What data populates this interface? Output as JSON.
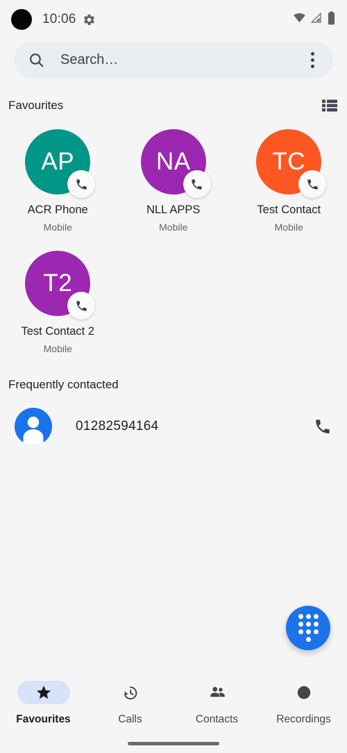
{
  "status_bar": {
    "time": "10:06",
    "gear_icon": "gear-icon",
    "wifi_icon": "wifi-icon",
    "signal_icon": "cellular-signal-icon",
    "battery_icon": "battery-full-icon"
  },
  "search": {
    "placeholder": "Search…",
    "search_icon": "search-icon",
    "overflow_icon": "overflow-menu-icon"
  },
  "favourites_section": {
    "title": "Favourites",
    "view_toggle_icon": "list-view-icon",
    "contacts": [
      {
        "initials": "AP",
        "name": "ACR Phone",
        "label": "Mobile",
        "color": "#009688",
        "badge_icon": "phone-call-icon"
      },
      {
        "initials": "NA",
        "name": "NLL APPS",
        "label": "Mobile",
        "color": "#9c27b0",
        "badge_icon": "phone-call-icon"
      },
      {
        "initials": "TC",
        "name": "Test Contact",
        "label": "Mobile",
        "color": "#ff5722",
        "badge_icon": "phone-call-icon"
      },
      {
        "initials": "T2",
        "name": "Test Contact 2",
        "label": "Mobile",
        "color": "#9c27b0",
        "badge_icon": "phone-call-icon"
      }
    ]
  },
  "frequently_contacted": {
    "title": "Frequently contacted",
    "entries": [
      {
        "number": "01282594164",
        "avatar_icon": "person-avatar-icon",
        "avatar_color": "#1a73e8",
        "call_icon": "phone-call-icon"
      }
    ]
  },
  "fab": {
    "icon": "dialpad-icon",
    "color": "#1a73e8"
  },
  "bottom_nav": {
    "items": [
      {
        "label": "Favourites",
        "icon": "star-icon",
        "active": true
      },
      {
        "label": "Calls",
        "icon": "call-history-icon",
        "active": false
      },
      {
        "label": "Contacts",
        "icon": "people-icon",
        "active": false
      },
      {
        "label": "Recordings",
        "icon": "record-dot-icon",
        "active": false
      }
    ],
    "active_pill_color": "#d7e3f8"
  }
}
